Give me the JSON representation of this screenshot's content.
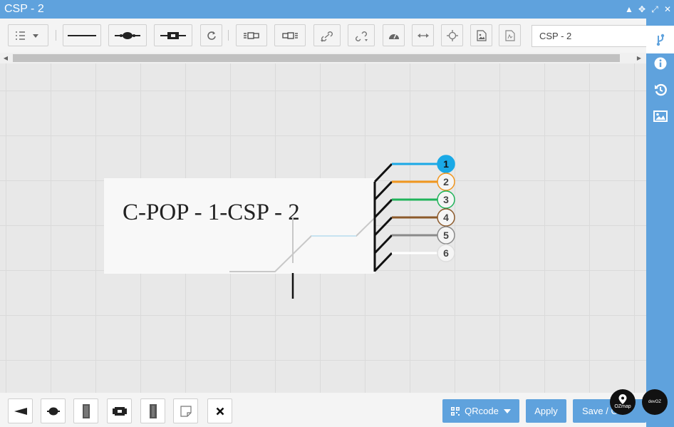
{
  "window": {
    "title": "CSP - 2"
  },
  "toolbar": {
    "title_value": "CSP - 2"
  },
  "diagram": {
    "label": "C-POP - 1-CSP - 2",
    "fibers": [
      {
        "number": "1",
        "color": "#1aa9e6"
      },
      {
        "number": "2",
        "color": "#f0961e"
      },
      {
        "number": "3",
        "color": "#20b35a"
      },
      {
        "number": "4",
        "color": "#8c5a2b"
      },
      {
        "number": "5",
        "color": "#8a8a8a"
      },
      {
        "number": "6",
        "color": "#ffffff"
      }
    ]
  },
  "bottombar": {
    "qrcode_label": "QRcode",
    "apply_label": "Apply",
    "save_label": "Save / C"
  },
  "branding": {
    "ozmap": "OZmap",
    "devoz": "devOZ"
  },
  "colors": {
    "accent": "#5fa2dd",
    "canvas": "#e8e8e8",
    "toolbar": "#f4f4f4"
  }
}
